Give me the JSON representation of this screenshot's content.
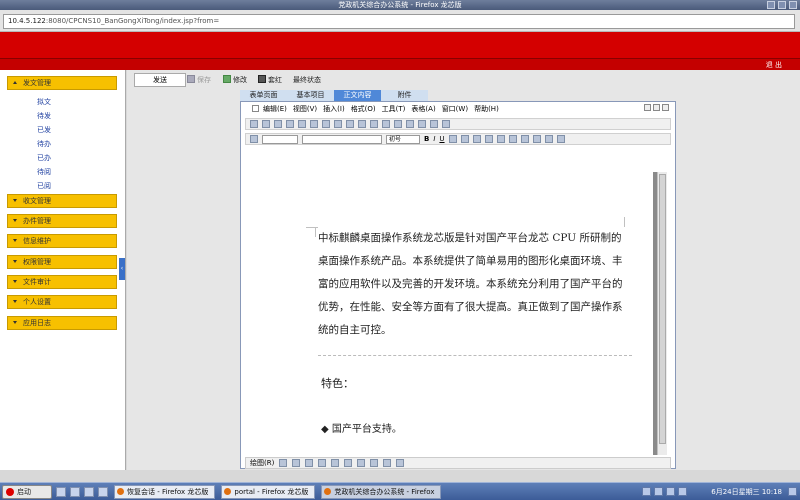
{
  "window": {
    "title": "党政机关综合办公系统 - Firefox 龙芯版"
  },
  "browser": {
    "url_host": "10.4.5.122",
    "url_rest": ":8080/CPCNS10_BanGongXiTong/index.jsp?from="
  },
  "header": {
    "logout_label": "退 出"
  },
  "sidebar": {
    "sections": [
      {
        "label": "发文管理",
        "expanded": true,
        "items": [
          "拟文",
          "待发",
          "已发",
          "待办",
          "已办",
          "待阅",
          "已阅"
        ]
      },
      {
        "label": "收文管理",
        "expanded": false
      },
      {
        "label": "办件管理",
        "expanded": false
      },
      {
        "label": "信息维护",
        "expanded": false
      },
      {
        "label": "权限管理",
        "expanded": false
      },
      {
        "label": "文件审计",
        "expanded": false
      },
      {
        "label": "个人设置",
        "expanded": false
      },
      {
        "label": "应用日志",
        "expanded": false
      }
    ],
    "colors": {
      "section_bg": "#f7c000",
      "item_text": "#1e3fa0"
    }
  },
  "actions": {
    "send": "发送",
    "save": "保存",
    "edit": "修改",
    "redhead": "套红",
    "final_state": "最终状态"
  },
  "tabs": [
    {
      "label": "表单页面",
      "active": false
    },
    {
      "label": "基本项目",
      "active": false
    },
    {
      "label": "正文内容",
      "active": true
    },
    {
      "label": "附件",
      "active": false
    }
  ],
  "editor": {
    "menus": [
      "编辑(E)",
      "视图(V)",
      "插入(I)",
      "格式(O)",
      "工具(T)",
      "表格(A)",
      "窗口(W)",
      "帮助(H)"
    ],
    "font_size": "初号",
    "drawing_label": "绘图(R)",
    "body_text": "中标麒麟桌面操作系统龙芯版是针对国产平台龙芯 CPU 所研制的桌面操作系统产品。本系统提供了简单易用的图形化桌面环境、丰富的应用软件以及完善的开发环境。本系统充分利用了国产平台的优势，在性能、安全等方面有了很大提高。真正做到了国产操作系统的自主可控。",
    "section_heading": "特色：",
    "bullet": "国产平台支持。"
  },
  "taskbar": {
    "start_label": "启动",
    "tasks": [
      {
        "label": "恢复会话 - Firefox 龙芯版",
        "active": false
      },
      {
        "label": "portal - Firefox 龙芯版",
        "active": false
      },
      {
        "label": "党政机关综合办公系统 - Firefox",
        "active": true
      }
    ],
    "clock": "6月24日星期三 10:18"
  },
  "theme": {
    "banner_red": "#d40000",
    "tab_active": "#4f88d8",
    "taskbar_blue": "#3c5c98"
  }
}
